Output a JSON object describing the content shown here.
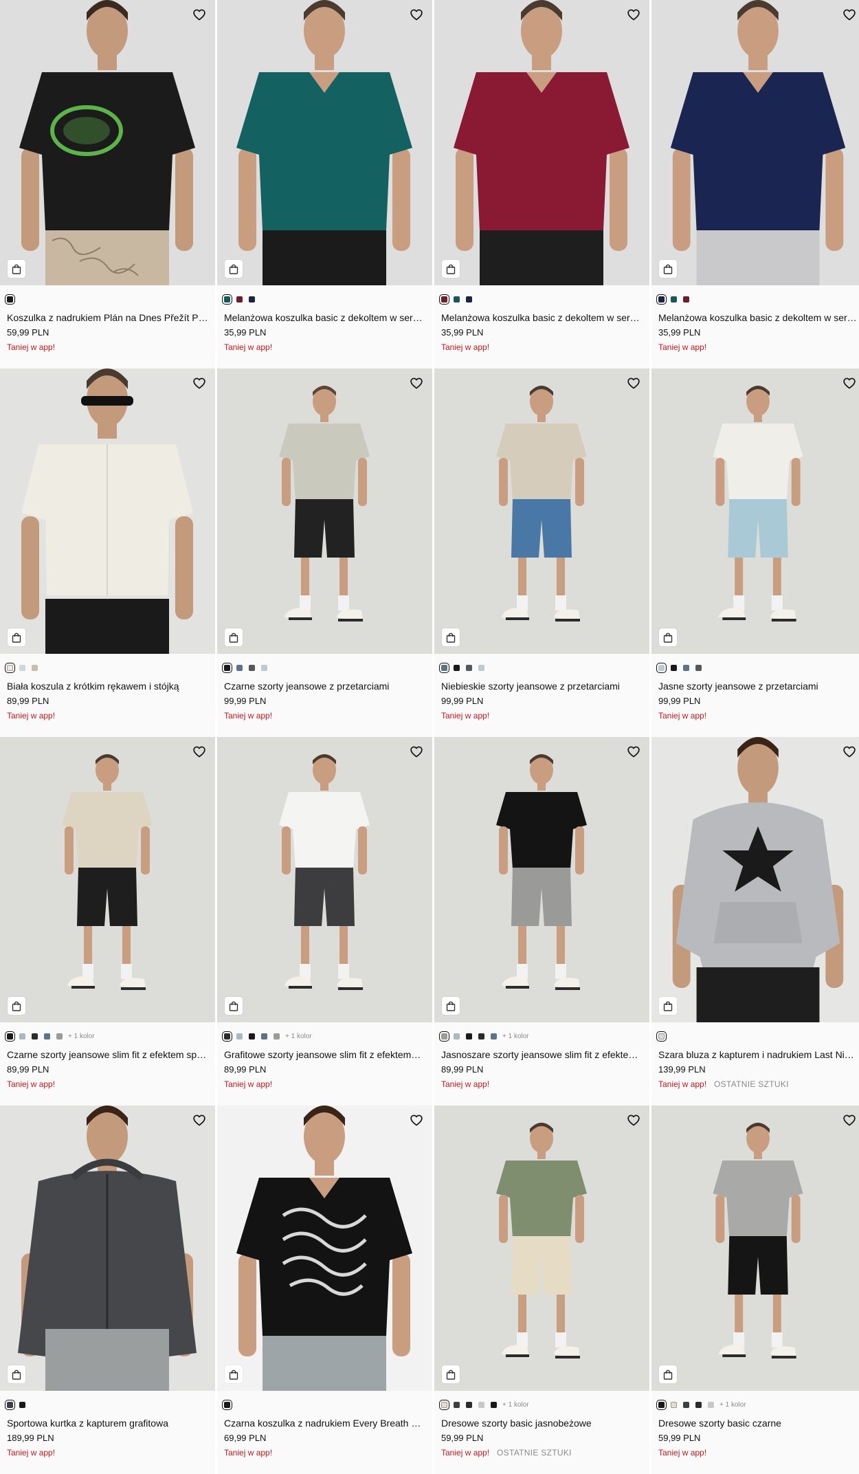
{
  "products": [
    {
      "name": "Koszulka z nadrukiem Plán na Dnes Přežít Př…",
      "price": "59,99 PLN",
      "promo": "Taniej w app!",
      "colors": [
        "#1a1a1a"
      ],
      "photo": {
        "bg": "#dedede",
        "skin": "#c49a7c",
        "hair": "#3a2a20",
        "top": "#1b1b1b",
        "top_type": "tee-back",
        "bottom": "#c9b8a1",
        "bottom_type": "camo",
        "print": "#5bb34a"
      }
    },
    {
      "name": "Melanżowa koszulka basic z dekoltem w ser…",
      "price": "35,99 PLN",
      "promo": "Taniej w app!",
      "colors": [
        "#17595a",
        "#6e1e2b",
        "#1c2444"
      ],
      "photo": {
        "bg": "#dedede",
        "skin": "#c99e80",
        "hair": "#4a3a30",
        "top": "#136160",
        "top_type": "tee",
        "bottom": "#1b1b1b",
        "bottom_type": "dark"
      }
    },
    {
      "name": "Melanżowa koszulka basic z dekoltem w ser…",
      "price": "35,99 PLN",
      "promo": "Taniej w app!",
      "colors": [
        "#6e1e2b",
        "#17595a",
        "#1c2444"
      ],
      "photo": {
        "bg": "#dedede",
        "skin": "#c99e80",
        "hair": "#4a3a30",
        "top": "#8a1a33",
        "top_type": "tee",
        "bottom": "#1e1e1e",
        "bottom_type": "dark"
      }
    },
    {
      "name": "Melanżowa koszulka basic z dekoltem w ser…",
      "price": "35,99 PLN",
      "promo": "Taniej w app!",
      "colors": [
        "#1c2444",
        "#17595a",
        "#6e1e2b"
      ],
      "photo": {
        "bg": "#dedede",
        "skin": "#c99e80",
        "hair": "#4a3a30",
        "top": "#1a2651",
        "top_type": "tee",
        "bottom": "#c9c9cc",
        "bottom_type": "light"
      }
    },
    {
      "name": "Biała koszula z krótkim rękawem i stójką",
      "price": "89,99 PLN",
      "promo": "Taniej w app!",
      "colors": [
        "#ece8dc",
        "#cfd6dc",
        "#c8bfa8"
      ],
      "photo": {
        "bg": "#e2e2e0",
        "skin": "#c49a7c",
        "hair": "#4a3a30",
        "top": "#efece4",
        "top_type": "shirt",
        "bottom": "#1a1a1a",
        "bottom_type": "dark"
      }
    },
    {
      "name": "Czarne szorty jeansowe z przetarciami",
      "price": "99,99 PLN",
      "promo": "Taniej w app!",
      "colors": [
        "#1a1a1a",
        "#5d7487",
        "#54585a",
        "#c0cacd"
      ],
      "photo": {
        "bg": "#dcdcd9",
        "skin": "#c99e80",
        "hair": "#5a4632",
        "top": "#c9c9bd",
        "top_type": "fulltee",
        "bottom": "#222222",
        "bottom_type": "shorts"
      }
    },
    {
      "name": "Niebieskie szorty jeansowe z przetarciami",
      "price": "99,99 PLN",
      "promo": "Taniej w app!",
      "colors": [
        "#5d7487",
        "#1a1a1a",
        "#54585a",
        "#c0cacd"
      ],
      "photo": {
        "bg": "#dcdcd9",
        "skin": "#c99e80",
        "hair": "#4a3a30",
        "top": "#d6ccbb",
        "top_type": "fulltee",
        "bottom": "#4a78a6",
        "bottom_type": "shorts"
      }
    },
    {
      "name": "Jasne szorty jeansowe z przetarciami",
      "price": "99,99 PLN",
      "promo": "Taniej w app!",
      "colors": [
        "#c0cacd",
        "#1a1a1a",
        "#5d7487",
        "#54585a"
      ],
      "photo": {
        "bg": "#dcdcd9",
        "skin": "#c99e80",
        "hair": "#4a3a30",
        "top": "#f0eee8",
        "top_type": "fulltee",
        "bottom": "#aac9d6",
        "bottom_type": "shorts"
      }
    },
    {
      "name": "Czarne szorty jeansowe slim fit z efektem sp…",
      "price": "89,99 PLN",
      "promo": "Taniej w app!",
      "colors": [
        "#1a1a1a",
        "#aab9c0",
        "#2b2b2b",
        "#5d7487",
        "#9b9b98"
      ],
      "more": "+ 1 kolor",
      "photo": {
        "bg": "#dcdcd9",
        "skin": "#c99e80",
        "hair": "#4a3a30",
        "top": "#ddd4c2",
        "top_type": "fulltee",
        "bottom": "#1e1e1e",
        "bottom_type": "shorts"
      }
    },
    {
      "name": "Grafitowe szorty jeansowe slim fit z efektem…",
      "price": "89,99 PLN",
      "promo": "Taniej w app!",
      "colors": [
        "#2b2b2b",
        "#aab9c0",
        "#1a1a1a",
        "#5d7487",
        "#9b9b98"
      ],
      "more": "+ 1 kolor",
      "photo": {
        "bg": "#dcdcd9",
        "skin": "#c99e80",
        "hair": "#4a3a30",
        "top": "#f4f4f2",
        "top_type": "fulltee",
        "bottom": "#3d3d3f",
        "bottom_type": "shorts"
      }
    },
    {
      "name": "Jasnoszare szorty jeansowe slim fit z efekte…",
      "price": "89,99 PLN",
      "promo": "Taniej w app!",
      "colors": [
        "#9b9b98",
        "#aab9c0",
        "#1a1a1a",
        "#2b2b2b",
        "#5d7487"
      ],
      "more": "+ 1 kolor",
      "photo": {
        "bg": "#dcdcd9",
        "skin": "#c99e80",
        "hair": "#4a3a30",
        "top": "#141414",
        "top_type": "fulltee",
        "bottom": "#9a9a98",
        "bottom_type": "shorts"
      }
    },
    {
      "name": "Szara bluza z kapturem i nadrukiem Last Nig…",
      "price": "139,99 PLN",
      "promo": "Taniej w app!",
      "status": "OSTATNIE SZTUKI",
      "colors": [
        "#d9d9d9"
      ],
      "photo": {
        "bg": "#e6e6e4",
        "skin": "#c49a7c",
        "hair": "#3a2418",
        "top": "#b9babd",
        "top_type": "hoodie",
        "bottom": "#1e1e1e",
        "bottom_type": "dark",
        "print": "#1a1a1a"
      }
    },
    {
      "name": "Sportowa kurtka z kapturem grafitowa",
      "price": "189,99 PLN",
      "promo": "Taniej w app!",
      "colors": [
        "#3d3f42",
        "#1a1a1a"
      ],
      "photo": {
        "bg": "#e2e2e0",
        "skin": "#c49a7c",
        "hair": "#3a2418",
        "top": "#45474b",
        "top_type": "jacket",
        "bottom": "#9b9e9f",
        "bottom_type": "light"
      }
    },
    {
      "name": "Czarna koszulka z nadrukiem Every Breath B…",
      "price": "69,99 PLN",
      "promo": "Taniej w app!",
      "colors": [
        "#1a1a1a"
      ],
      "photo": {
        "bg": "#f2f2f2",
        "skin": "#c99e80",
        "hair": "#3a2418",
        "top": "#131313",
        "top_type": "tee",
        "bottom": "#9ea5a8",
        "bottom_type": "light",
        "print": "#d8d8d8"
      }
    },
    {
      "name": "Dresowe szorty basic jasnobeżowe",
      "price": "59,99 PLN",
      "promo": "Taniej w app!",
      "status": "OSTATNIE SZTUKI",
      "colors": [
        "#e4dcc6",
        "#3d3f42",
        "#2b2b2b",
        "#c8c8c8",
        "#1a1a1a"
      ],
      "more": "+ 1 kolor",
      "photo": {
        "bg": "#dcdcd9",
        "skin": "#c99e80",
        "hair": "#4a3a30",
        "top": "#7f8e6e",
        "top_type": "fulltee",
        "bottom": "#e6dcc6",
        "bottom_type": "shorts"
      }
    },
    {
      "name": "Dresowe szorty basic czarne",
      "price": "59,99 PLN",
      "promo": "Taniej w app!",
      "colors": [
        "#1a1a1a",
        "#e4dcc6",
        "#3d3f42",
        "#2b2b2b",
        "#c8c8c8"
      ],
      "more": "+ 1 kolor",
      "photo": {
        "bg": "#dcdcd9",
        "skin": "#c99e80",
        "hair": "#4a3a30",
        "top": "#a9a9a7",
        "top_type": "fulltee",
        "bottom": "#151515",
        "bottom_type": "shorts"
      }
    }
  ]
}
